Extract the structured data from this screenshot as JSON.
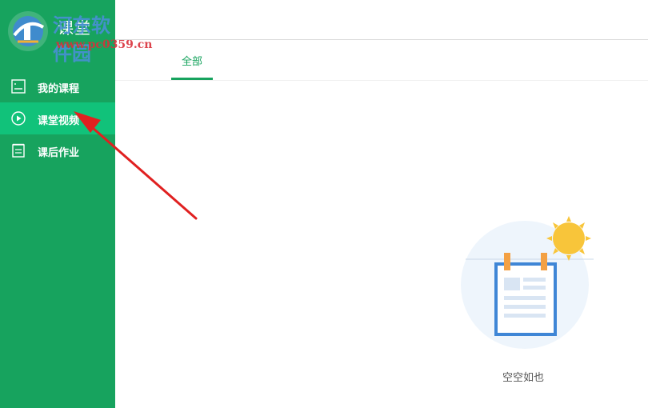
{
  "app": {
    "title": "课堂"
  },
  "watermark": {
    "site_name": "河东软件园",
    "url": "www.pc0359.cn"
  },
  "sidebar": {
    "items": [
      {
        "label": "我的课程",
        "icon": "course-list-icon",
        "active": false
      },
      {
        "label": "课堂视频",
        "icon": "play-circle-icon",
        "active": true
      },
      {
        "label": "课后作业",
        "icon": "homework-icon",
        "active": false
      }
    ]
  },
  "main": {
    "tabs": [
      {
        "label": "全部",
        "active": true
      }
    ],
    "empty_state": {
      "message": "空空如也"
    }
  },
  "colors": {
    "sidebar_bg": "#17a35e",
    "active_item_bg": "#11c27a",
    "accent": "#17a35e",
    "annotation_arrow": "#e02020"
  }
}
